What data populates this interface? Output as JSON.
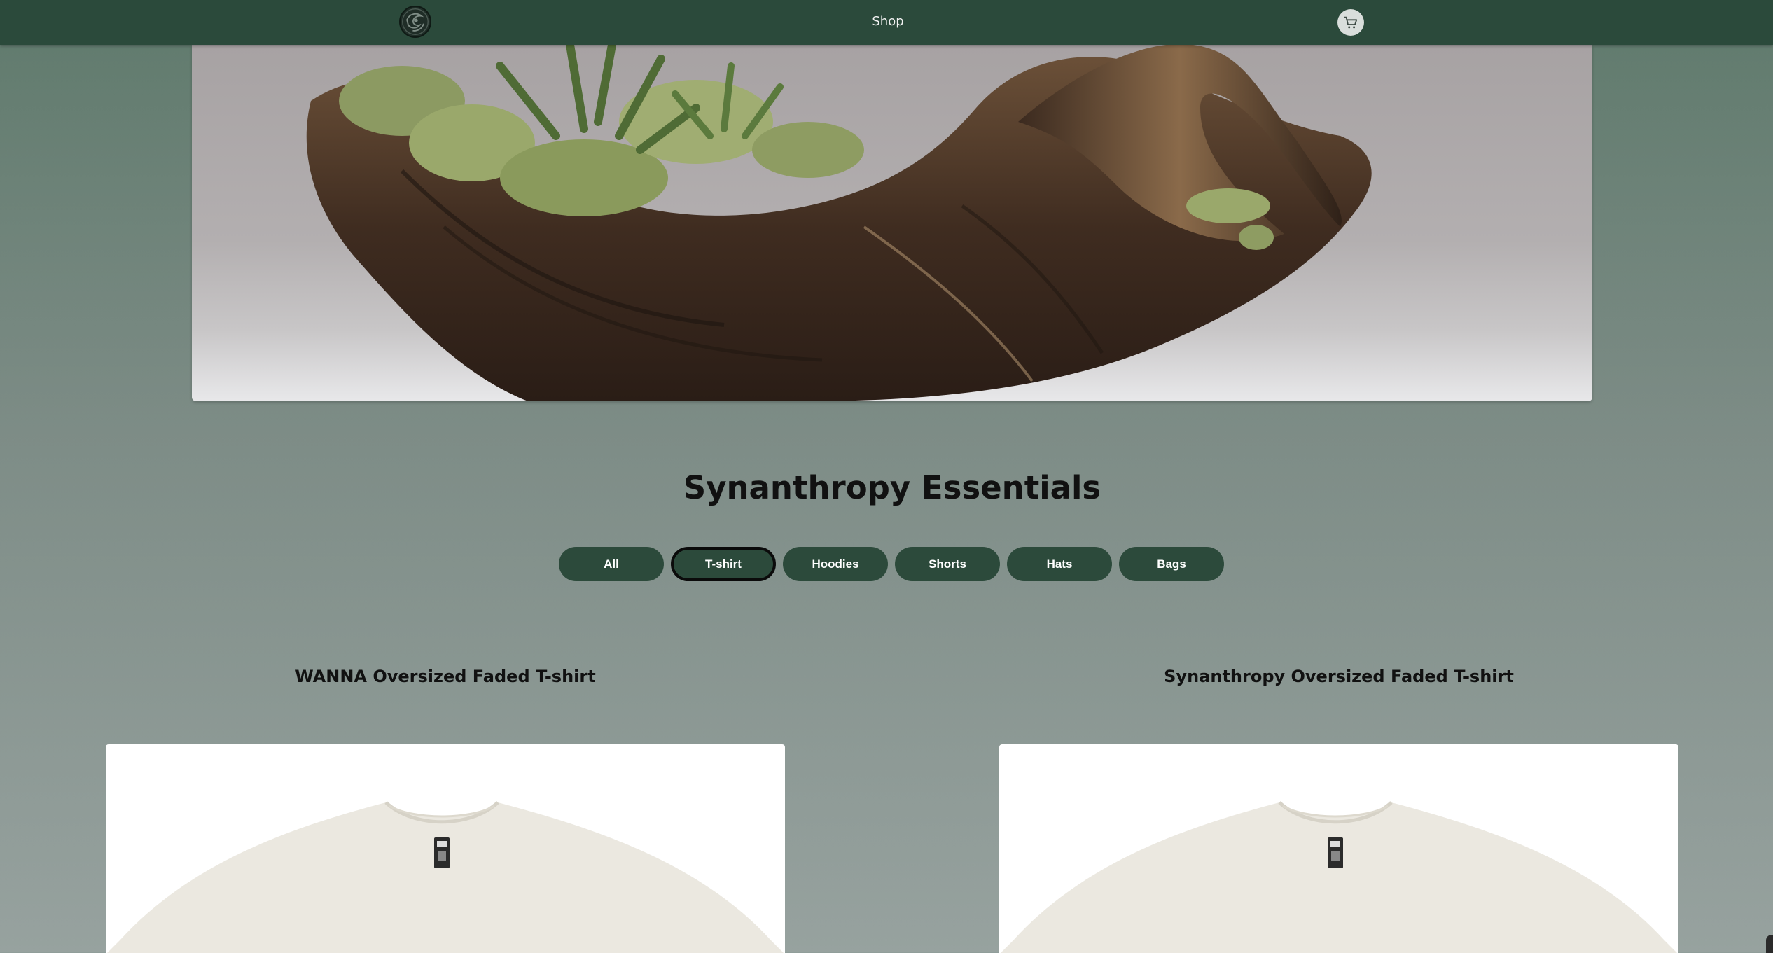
{
  "header": {
    "logo_icon": "synanthropy-logo-icon",
    "nav_shop_label": "Shop",
    "cart_icon": "cart-icon",
    "background_color": "#2b4a3b"
  },
  "hero": {
    "image_subject": "hero-driftwood-moss-image"
  },
  "section": {
    "title": "Synanthropy Essentials"
  },
  "filters": {
    "items": [
      "All",
      "T-shirt",
      "Hoodies",
      "Shorts",
      "Hats",
      "Bags"
    ],
    "active": "T-shirt",
    "chip_color": "#2c4a3b"
  },
  "products": [
    {
      "title": "WANNA Oversized Faded T-shirt",
      "image_icon": "tshirt-image"
    },
    {
      "title": "Synanthropy Oversized Faded T-shirt",
      "image_icon": "tshirt-image"
    }
  ]
}
